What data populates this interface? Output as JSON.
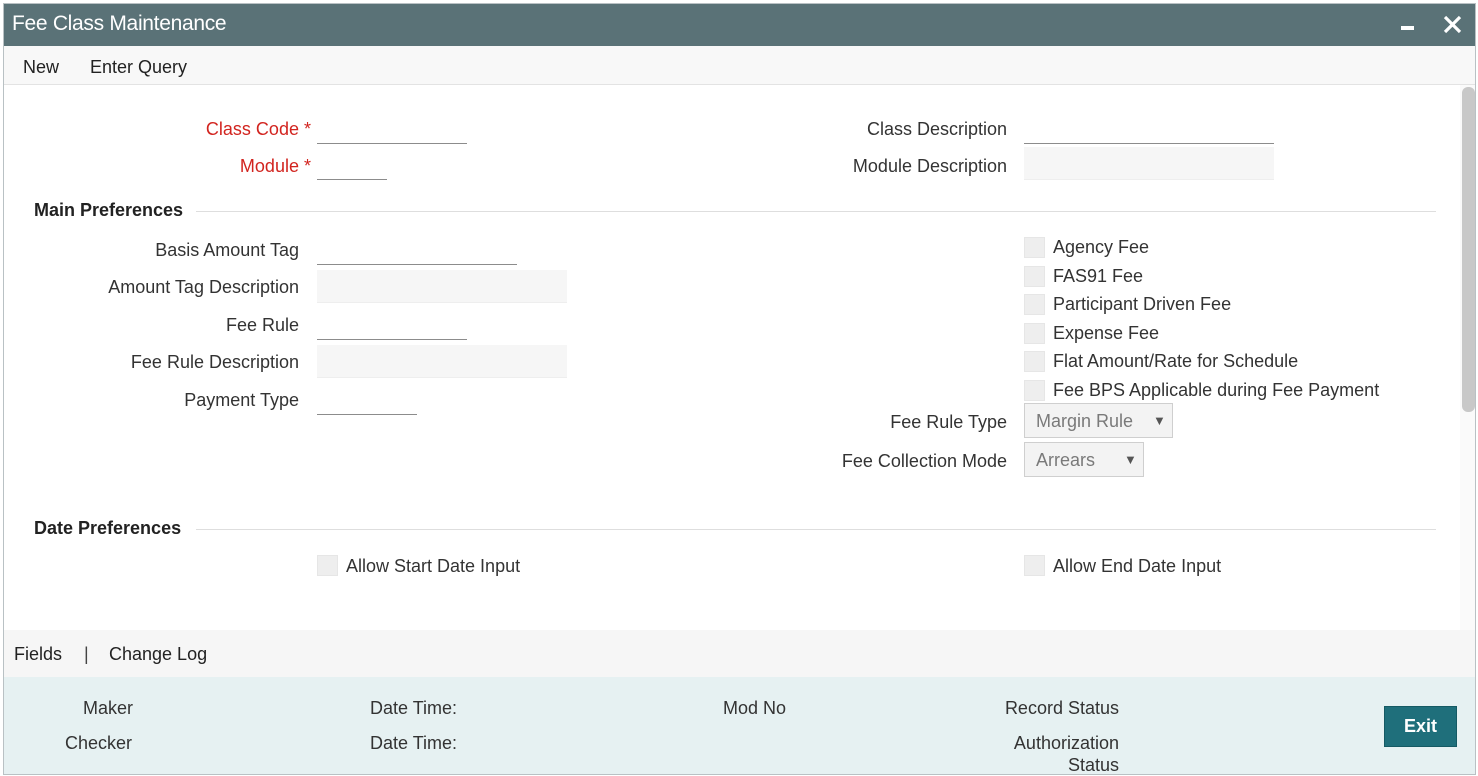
{
  "window": {
    "title": "Fee Class Maintenance"
  },
  "menu": {
    "new_label": "New",
    "enter_query_label": "Enter Query"
  },
  "form": {
    "class_code_label": "Class Code",
    "module_label": "Module",
    "required_mark": "*",
    "class_description_label": "Class Description",
    "module_description_label": "Module Description",
    "class_code_value": "",
    "module_value": "",
    "class_description_value": "",
    "module_description_value": ""
  },
  "main_preferences": {
    "title": "Main Preferences",
    "basis_amount_tag_label": "Basis Amount Tag",
    "amount_tag_description_label": "Amount Tag Description",
    "fee_rule_label": "Fee Rule",
    "fee_rule_description_label": "Fee Rule Description",
    "payment_type_label": "Payment Type",
    "checkboxes": [
      {
        "label": "Agency Fee",
        "checked": false
      },
      {
        "label": "FAS91 Fee",
        "checked": false
      },
      {
        "label": "Participant Driven Fee",
        "checked": false
      },
      {
        "label": "Expense Fee",
        "checked": false
      },
      {
        "label": "Flat Amount/Rate for Schedule",
        "checked": false
      },
      {
        "label": "Fee BPS Applicable during Fee Payment",
        "checked": false
      }
    ],
    "fee_rule_type_label": "Fee Rule Type",
    "fee_rule_type_value": "Margin Rule",
    "fee_collection_mode_label": "Fee Collection Mode",
    "fee_collection_mode_value": "Arrears"
  },
  "date_preferences": {
    "title": "Date Preferences",
    "allow_start_date_label": "Allow Start Date Input",
    "allow_end_date_label": "Allow End Date Input"
  },
  "footer": {
    "fields_label": "Fields",
    "separator": "|",
    "change_log_label": "Change Log"
  },
  "audit": {
    "maker_label": "Maker",
    "checker_label": "Checker",
    "date_time_label_1": "Date Time:",
    "date_time_label_2": "Date Time:",
    "mod_no_label": "Mod No",
    "record_status_label": "Record Status",
    "authorization_label": "Authorization",
    "status_label": "Status",
    "exit_label": "Exit"
  },
  "icons": {
    "minimize": "minimize-icon",
    "close": "close-icon",
    "dropdown": "dropdown-arrow-icon"
  },
  "colors": {
    "titlebar": "#5a7277",
    "required": "#d2241f",
    "exit_button": "#1f6f7b",
    "audit_bg": "#e6f1f2"
  }
}
